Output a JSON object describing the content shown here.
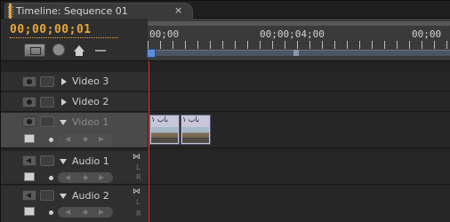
{
  "panel": {
    "tab_title": "Timeline: Sequence 01",
    "tab_close": "×"
  },
  "header": {
    "timecode": "00;00;00;01",
    "ruler_labels": [
      "00;00",
      "00;00;04;00",
      "00;00"
    ]
  },
  "tracks": {
    "video": [
      {
        "name": "Video 3"
      },
      {
        "name": "Video 2"
      },
      {
        "name": "Video 1"
      }
    ],
    "audio": [
      {
        "name": "Audio 1",
        "L": "L",
        "R": "R"
      },
      {
        "name": "Audio 2",
        "L": "L",
        "R": "R"
      }
    ]
  },
  "clips": [
    {
      "label": "ﺑﺎﺏ ١"
    },
    {
      "label": "ﺑﺎﺏ ١"
    }
  ],
  "colors": {
    "timecode": "#e9a63a",
    "playhead": "#e23b2f",
    "playhead_handle": "#5d8cd6"
  },
  "icons": {
    "snap": "snap-icon",
    "marker": "set-marker-icon",
    "home": "home-icon",
    "eye": "eye-icon",
    "speaker": "speaker-icon",
    "lock": "lock-icon"
  }
}
